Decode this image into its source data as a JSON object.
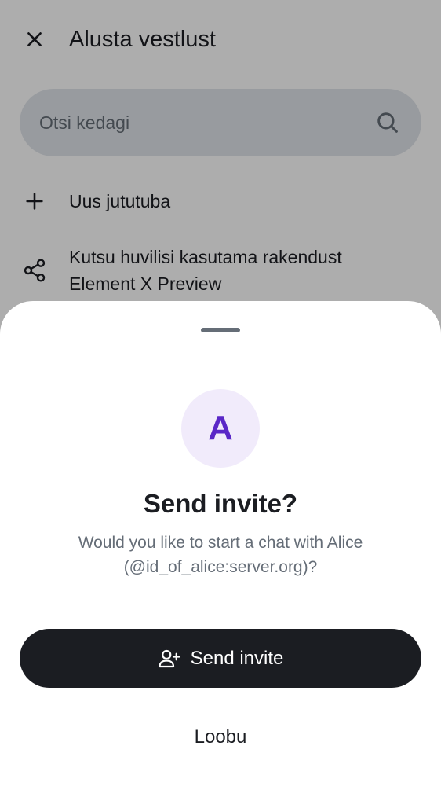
{
  "colors": {
    "primary": "#1b1d22",
    "secondary_text": "#656d77",
    "search_bg": "#e1e5ea",
    "avatar_bg": "#f1ebfb",
    "avatar_fg": "#5a27c7"
  },
  "header": {
    "close_icon": "close-icon",
    "title": "Alusta vestlust"
  },
  "search": {
    "placeholder": "Otsi kedagi",
    "icon": "search-icon"
  },
  "actions": [
    {
      "icon": "plus-icon",
      "label": "Uus jututuba"
    },
    {
      "icon": "share-icon",
      "label_line1": "Kutsu huvilisi kasutama rakendust",
      "label_line2": "Element X Preview"
    }
  ],
  "dialog": {
    "avatar_initial": "A",
    "title": "Send invite?",
    "body_line1": "Would you like to start a chat with Alice",
    "body_line2": "(@id_of_alice:server.org)?",
    "primary_button": {
      "icon": "add-user-icon",
      "label": "Send invite"
    },
    "secondary_button": {
      "label": "Loobu"
    }
  }
}
